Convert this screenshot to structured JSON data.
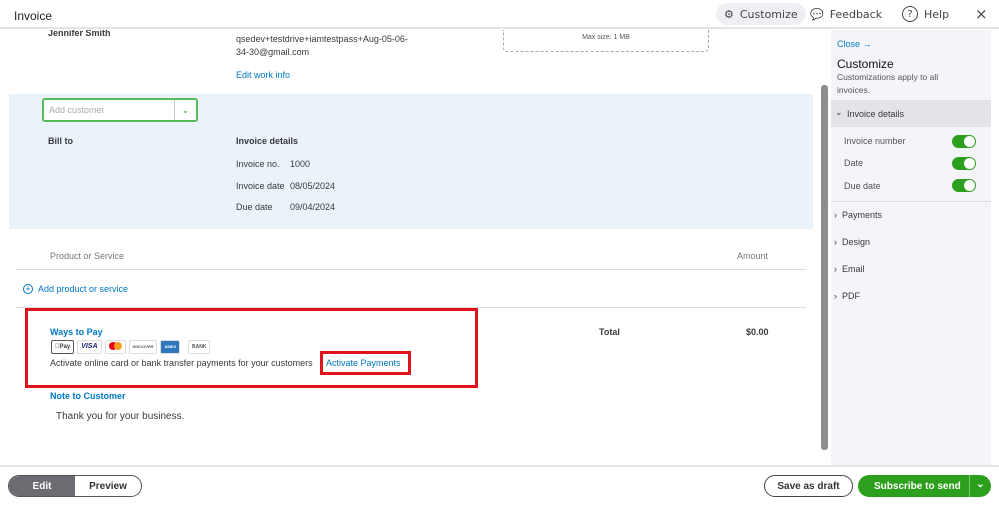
{
  "header": {
    "title": "Invoice",
    "customize": "Customize",
    "feedback": "Feedback",
    "help": "Help"
  },
  "customer": {
    "name": "Jennifer Smith",
    "email_line1": "qsedev+testdrive+iamtestpass+Aug-05-06-",
    "email_line2": "34-30@gmail.com",
    "edit_work_info": "Edit work info",
    "logo_hint": "Max size: 1 MB"
  },
  "add_customer": {
    "placeholder": "Add customer"
  },
  "bill_to": "Bill to",
  "invoice_details": {
    "heading": "Invoice details",
    "number_label": "Invoice no.",
    "number": "1000",
    "date_label": "Invoice date",
    "date": "08/05/2024",
    "due_label": "Due date",
    "due": "09/04/2024"
  },
  "table": {
    "col_product": "Product or Service",
    "col_amount": "Amount",
    "add_line": "Add product or service"
  },
  "ways_to_pay": {
    "heading": "Ways to Pay",
    "cards": [
      "Pay",
      "VISA",
      "",
      "DISCOVER",
      "AMEX",
      "BANK"
    ],
    "text": "Activate online card or bank transfer payments for your customers",
    "activate": "Activate Payments"
  },
  "total": {
    "label": "Total",
    "value": "$0.00"
  },
  "note": {
    "heading": "Note to Customer",
    "text": "Thank you for your business."
  },
  "panel": {
    "close": "Close →",
    "title": "Customize",
    "subtitle1": "Customizations apply to all",
    "subtitle2": "invoices.",
    "section": "Invoice details",
    "toggles": [
      {
        "label": "Invoice number",
        "on": true
      },
      {
        "label": "Date",
        "on": true
      },
      {
        "label": "Due date",
        "on": true
      }
    ],
    "sections": [
      "Payments",
      "Design",
      "Email",
      "PDF"
    ]
  },
  "footer": {
    "edit": "Edit",
    "preview": "Preview",
    "save_draft": "Save as draft",
    "subscribe": "Subscribe to send"
  },
  "colors": {
    "accent": "#2ca01c",
    "link": "#0077c5",
    "highlight": "#e0121b"
  }
}
